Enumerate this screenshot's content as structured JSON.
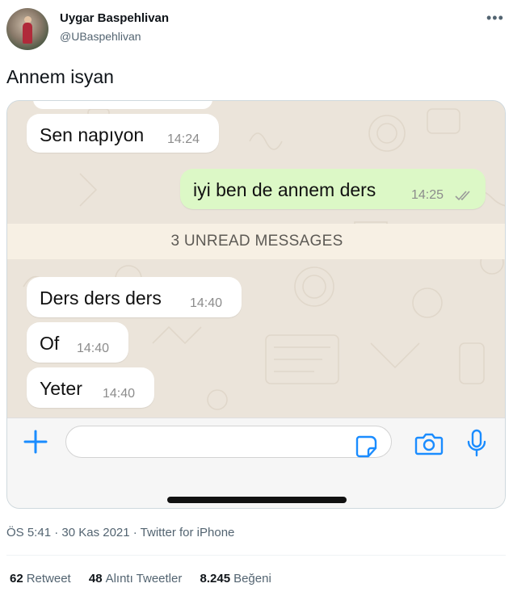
{
  "author": {
    "name": "Uygar Baspehlivan",
    "handle": "@UBaspehlivan"
  },
  "tweet": {
    "text": "Annem isyan"
  },
  "chat": {
    "messages": [
      {
        "direction": "in",
        "text": "Sen napıyon",
        "time": "14:24"
      },
      {
        "direction": "out",
        "text": "iyi ben de annem ders",
        "time": "14:25"
      },
      {
        "direction": "in",
        "text": "Ders ders ders",
        "time": "14:40"
      },
      {
        "direction": "in",
        "text": "Of",
        "time": "14:40"
      },
      {
        "direction": "in",
        "text": "Yeter",
        "time": "14:40"
      }
    ],
    "unread_banner": "3 UNREAD MESSAGES",
    "compose": {
      "plus_icon": "plus-icon",
      "sticker_icon": "sticker-icon",
      "camera_icon": "camera-icon",
      "mic_icon": "microphone-icon",
      "accent": "#1a8cff"
    }
  },
  "meta": "ÖS 5:41 · 30 Kas 2021 · Twitter for iPhone",
  "stats": {
    "retweets": {
      "count": "62",
      "label": "Retweet"
    },
    "quotes": {
      "count": "48",
      "label": "Alıntı Tweetler"
    },
    "likes": {
      "count": "8.245",
      "label": "Beğeni"
    }
  },
  "colors": {
    "incoming_bubble": "#ffffff",
    "outgoing_bubble": "#dcf8c6",
    "chat_background": "#ebe4da",
    "read_ticks": "#9a9a9a"
  }
}
